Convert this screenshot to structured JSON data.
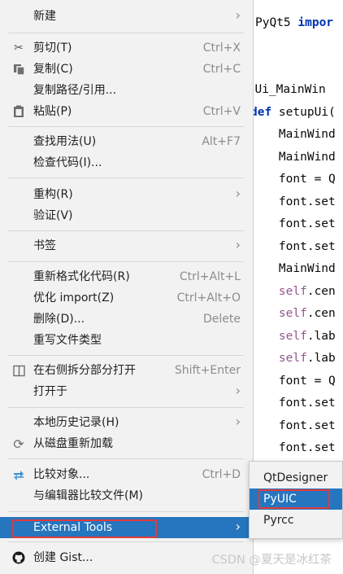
{
  "editor": {
    "lines": [
      {
        "pre": "PyQt5 ",
        "kw": "impor",
        "post": ""
      },
      {
        "pre": "",
        "kw": "",
        "post": ""
      },
      {
        "pre": "s Ui_MainWin",
        "kw": "",
        "post": ""
      },
      {
        "pre": "",
        "kw": "def",
        "post": " setupUi("
      },
      {
        "pre": "    MainWind",
        "kw": "",
        "post": ""
      },
      {
        "pre": "    MainWind",
        "kw": "",
        "post": ""
      },
      {
        "pre": "    font = Q",
        "kw": "",
        "post": ""
      },
      {
        "pre": "    font.set",
        "kw": "",
        "post": ""
      },
      {
        "pre": "    font.set",
        "kw": "",
        "post": ""
      },
      {
        "pre": "    font.set",
        "kw": "",
        "post": ""
      },
      {
        "pre": "    MainWind",
        "kw": "",
        "post": ""
      },
      {
        "pre": "    ",
        "self": "self",
        "post": ".cen"
      },
      {
        "pre": "    ",
        "self": "self",
        "post": ".cen"
      },
      {
        "pre": "    ",
        "self": "self",
        "post": ".lab"
      },
      {
        "pre": "    ",
        "self": "self",
        "post": ".lab"
      },
      {
        "pre": "    font = Q",
        "kw": "",
        "post": ""
      },
      {
        "pre": "    font.set",
        "kw": "",
        "post": ""
      },
      {
        "pre": "    font.set",
        "kw": "",
        "post": ""
      },
      {
        "pre": "    font.set",
        "kw": "",
        "post": ""
      }
    ]
  },
  "menu": {
    "items": [
      {
        "label": "新建",
        "shortcut": "",
        "icon": "",
        "submenu": true
      },
      {
        "label": "剪切(T)",
        "shortcut": "Ctrl+X",
        "icon": "scissors-icon",
        "submenu": false
      },
      {
        "label": "复制(C)",
        "shortcut": "Ctrl+C",
        "icon": "copy-icon",
        "submenu": false
      },
      {
        "label": "复制路径/引用...",
        "shortcut": "",
        "icon": "",
        "submenu": false
      },
      {
        "label": "粘贴(P)",
        "shortcut": "Ctrl+V",
        "icon": "paste-icon",
        "submenu": false
      },
      {
        "label": "查找用法(U)",
        "shortcut": "Alt+F7",
        "icon": "",
        "submenu": false
      },
      {
        "label": "检查代码(I)...",
        "shortcut": "",
        "icon": "",
        "submenu": false
      },
      {
        "label": "重构(R)",
        "shortcut": "",
        "icon": "",
        "submenu": true
      },
      {
        "label": "验证(V)",
        "shortcut": "",
        "icon": "",
        "submenu": false
      },
      {
        "label": "书签",
        "shortcut": "",
        "icon": "",
        "submenu": true
      },
      {
        "label": "重新格式化代码(R)",
        "shortcut": "Ctrl+Alt+L",
        "icon": "",
        "submenu": false
      },
      {
        "label": "优化 import(Z)",
        "shortcut": "Ctrl+Alt+O",
        "icon": "",
        "submenu": false
      },
      {
        "label": "删除(D)...",
        "shortcut": "Delete",
        "icon": "",
        "submenu": false
      },
      {
        "label": "重写文件类型",
        "shortcut": "",
        "icon": "",
        "submenu": false
      },
      {
        "label": "在右侧拆分部分打开",
        "shortcut": "Shift+Enter",
        "icon": "split-icon",
        "submenu": false
      },
      {
        "label": "打开于",
        "shortcut": "",
        "icon": "",
        "submenu": true
      },
      {
        "label": "本地历史记录(H)",
        "shortcut": "",
        "icon": "",
        "submenu": true
      },
      {
        "label": "从磁盘重新加载",
        "shortcut": "",
        "icon": "reload-icon",
        "submenu": false
      },
      {
        "label": "比较对象...",
        "shortcut": "Ctrl+D",
        "icon": "compare-icon",
        "submenu": false
      },
      {
        "label": "与编辑器比较文件(M)",
        "shortcut": "",
        "icon": "",
        "submenu": false
      },
      {
        "label": "External Tools",
        "shortcut": "",
        "icon": "",
        "submenu": true
      },
      {
        "label": "创建 Gist...",
        "shortcut": "",
        "icon": "github-icon",
        "submenu": false
      }
    ]
  },
  "submenu": {
    "items": [
      {
        "label": "QtDesigner"
      },
      {
        "label": "PyUIC"
      },
      {
        "label": "Pyrcc"
      }
    ]
  },
  "watermark": "CSDN @夏天是冰红茶",
  "colors": {
    "selection": "#2675bf",
    "highlight_box": "#e23a3a",
    "keyword": "#0033b3",
    "self_keyword": "#94558d"
  }
}
